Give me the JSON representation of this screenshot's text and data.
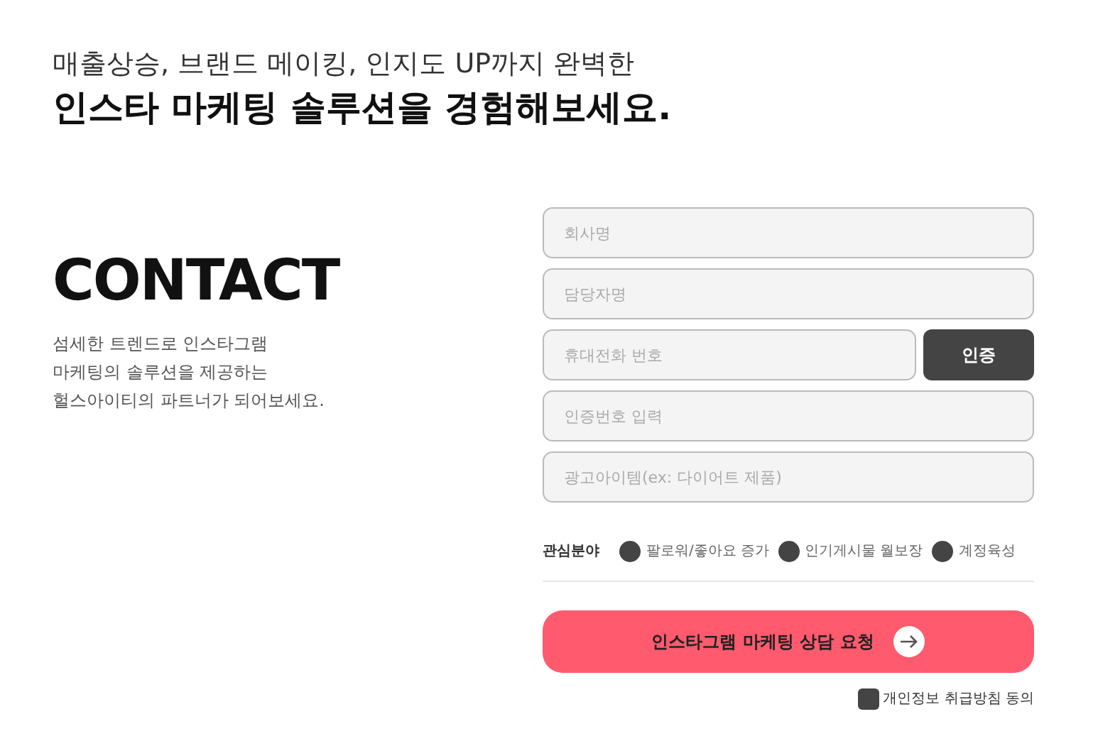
{
  "heading": {
    "subtitle": "매출상승, 브랜드 메이킹, 인지도 UP까지 완벽한",
    "title": "인스타 마케팅 솔루션을 경험해보세요."
  },
  "contact": {
    "title": "CONTACT",
    "lines": [
      "섬세한 트렌드로 인스타그램",
      "마케팅의 솔루션을 제공하는",
      "헐스아이티의 파트너가 되어보세요."
    ]
  },
  "form": {
    "fields": [
      {
        "placeholder": "회사명"
      },
      {
        "placeholder": "담당자명"
      },
      {
        "placeholder": "휴대전화 번호",
        "button": "인증"
      },
      {
        "placeholder": "인증번호 입력"
      },
      {
        "placeholder": "광고아이템(ex: 다이어트 제품)"
      }
    ],
    "interest": {
      "label": "관심분야",
      "options": [
        {
          "label": "팔로워/좋아요 증가",
          "selected": false
        },
        {
          "label": "인기게시물 월보장",
          "selected": false
        },
        {
          "label": "계정육성",
          "selected": false
        }
      ]
    },
    "submit": "인스타그램 마케팅 상담 요청",
    "consent": {
      "label": "개인정보 취급방침 동의",
      "checked": false
    }
  }
}
